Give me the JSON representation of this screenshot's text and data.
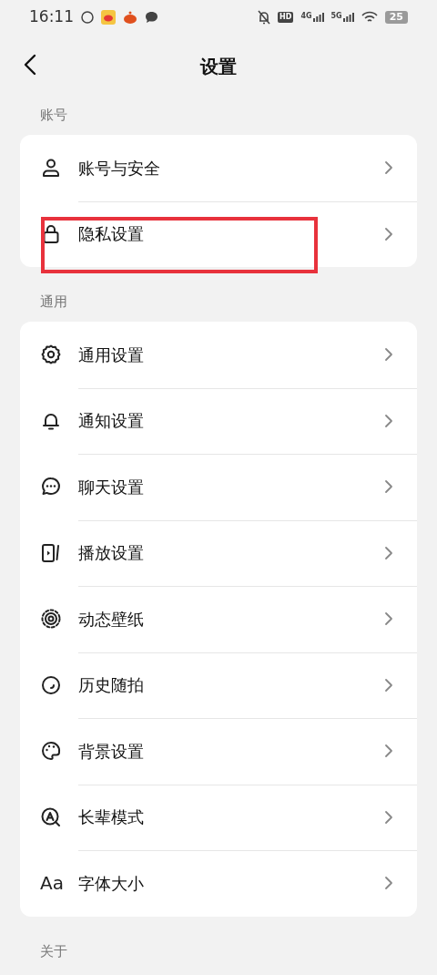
{
  "status_bar": {
    "time": "16:11",
    "hd": "HD",
    "networks": [
      "4G",
      "5G"
    ],
    "battery": "25"
  },
  "header": {
    "title": "设置"
  },
  "sections": [
    {
      "heading": "账号",
      "items": [
        {
          "label": "账号与安全",
          "kind": "person",
          "highlighted": false
        },
        {
          "label": "隐私设置",
          "kind": "lock",
          "highlighted": true
        }
      ]
    },
    {
      "heading": "通用",
      "items": [
        {
          "label": "通用设置",
          "kind": "gear",
          "highlighted": false
        },
        {
          "label": "通知设置",
          "kind": "bell",
          "highlighted": false
        },
        {
          "label": "聊天设置",
          "kind": "chat",
          "highlighted": false
        },
        {
          "label": "播放设置",
          "kind": "play",
          "highlighted": false
        },
        {
          "label": "动态壁纸",
          "kind": "wallpaper",
          "highlighted": false
        },
        {
          "label": "历史随拍",
          "kind": "history",
          "highlighted": false
        },
        {
          "label": "背景设置",
          "kind": "palette",
          "highlighted": false
        },
        {
          "label": "长辈模式",
          "kind": "elder",
          "highlighted": false
        },
        {
          "label": "字体大小",
          "kind": "text",
          "icon": "Aa",
          "highlighted": false
        }
      ]
    },
    {
      "heading": "关于"
    }
  ]
}
